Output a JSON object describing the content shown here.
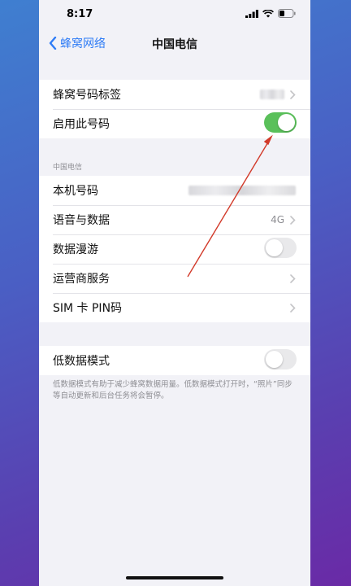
{
  "status": {
    "time": "8:17"
  },
  "nav": {
    "back_label": "蜂窝网络",
    "title": "中国电信"
  },
  "group1": {
    "label_row": {
      "label": "蜂窝号码标签"
    },
    "enable_row": {
      "label": "启用此号码",
      "toggle_on": true
    }
  },
  "section2": {
    "header": "中国电信",
    "number_row": {
      "label": "本机号码"
    },
    "voice_row": {
      "label": "语音与数据",
      "value": "4G"
    },
    "roaming_row": {
      "label": "数据漫游",
      "toggle_on": false
    },
    "carrier_row": {
      "label": "运营商服务"
    },
    "sim_row": {
      "label": "SIM 卡 PIN码"
    }
  },
  "group3": {
    "low_data_row": {
      "label": "低数据模式",
      "toggle_on": false
    },
    "footnote": "低数据模式有助于减少蜂窝数据用量。低数据模式打开时，“照片”同步等自动更新和后台任务将会暂停。"
  },
  "colors": {
    "accent": "#2f7cf6",
    "toggle_on": "#5ac05a",
    "annotation": "#d23a2a"
  }
}
